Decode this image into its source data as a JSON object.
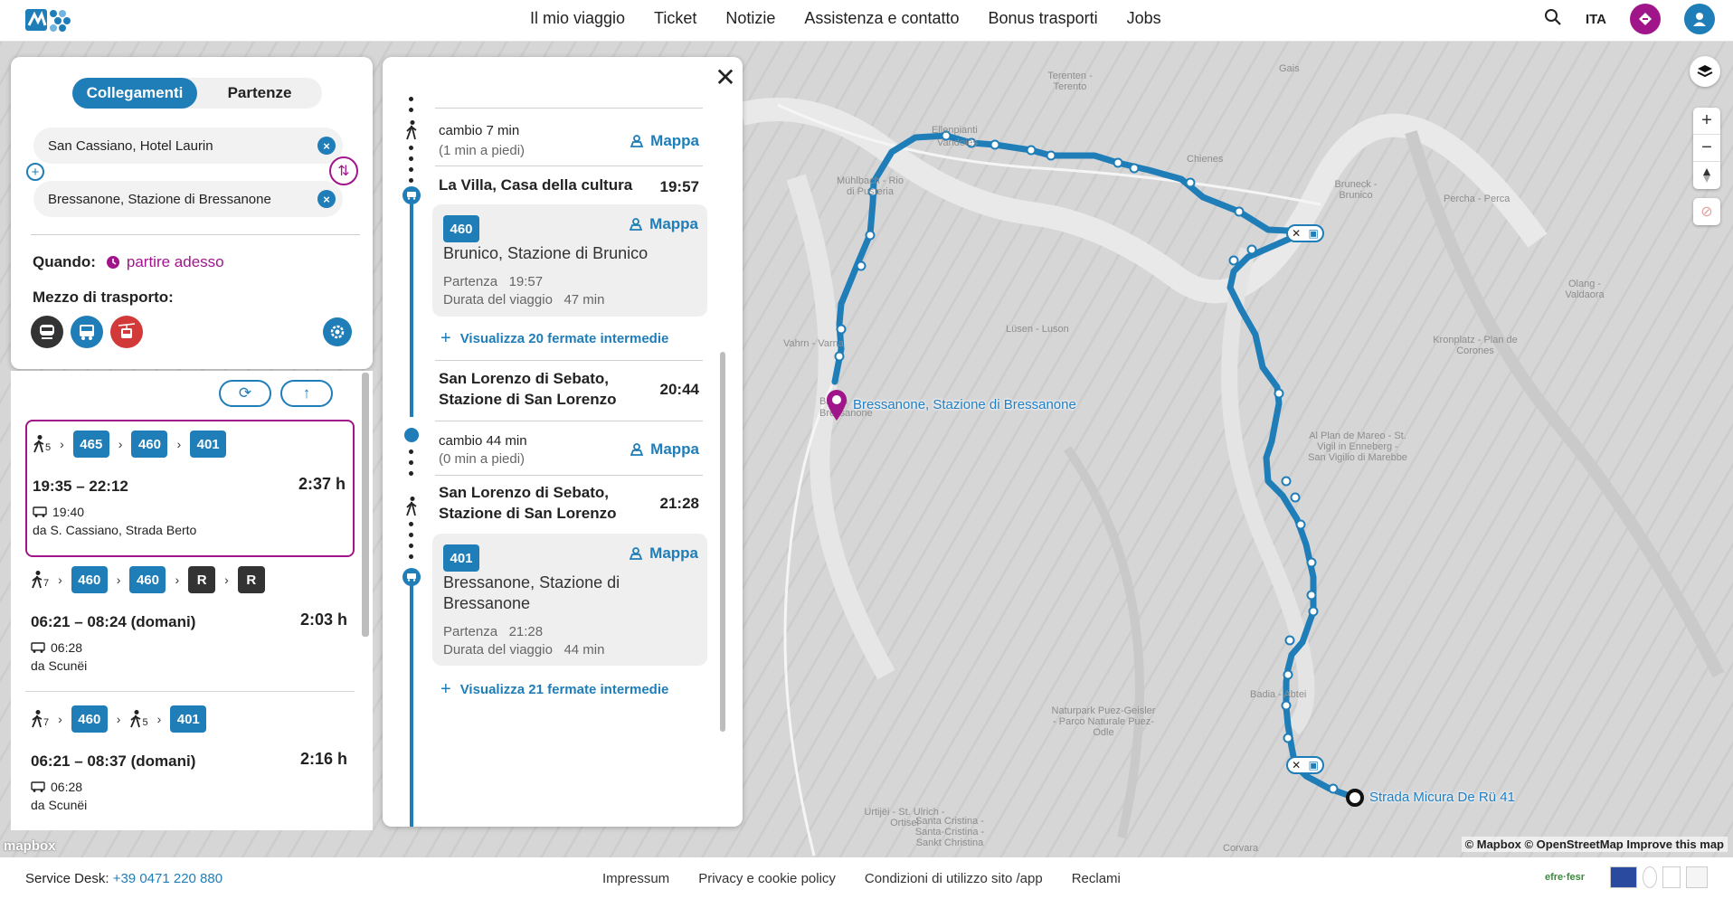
{
  "header": {
    "nav": [
      "Il mio viaggio",
      "Ticket",
      "Notizie",
      "Assistenza e contatto",
      "Bonus trasporti",
      "Jobs"
    ],
    "lang": "ITA"
  },
  "search": {
    "tabs": [
      "Collegamenti",
      "Partenze"
    ],
    "from": "San Cassiano, Hotel Laurin",
    "to": "Bressanone, Stazione di Bressanone",
    "when_label": "Quando:",
    "when_value": "partire adesso",
    "mezzo_label": "Mezzo di trasporto:"
  },
  "results": [
    {
      "walk_sub": "5",
      "lines": [
        "465",
        "460",
        "401"
      ],
      "time": "19:35 – 22:12",
      "duration": "2:37 h",
      "dep_time": "19:40",
      "from_stop": "da S. Cassiano, Strada Berto"
    },
    {
      "walk_sub": "7",
      "lines": [
        "460",
        "460",
        "R",
        "R"
      ],
      "time": "06:21 – 08:24 (domani)",
      "duration": "2:03 h",
      "dep_time": "06:28",
      "from_stop": "da Scunëi"
    },
    {
      "walk_sub": "7",
      "walk_sub2": "5",
      "lines": [
        "460",
        "401"
      ],
      "time": "06:21 – 08:37 (domani)",
      "duration": "2:16 h",
      "dep_time": "06:28",
      "from_stop": "da Scunëi"
    }
  ],
  "detail": {
    "change1": {
      "label": "cambio 7 min",
      "sub": "(1 min a piedi)",
      "map": "Mappa"
    },
    "stop1": {
      "name": "La Villa, Casa della cultura",
      "time": "19:57"
    },
    "leg1": {
      "line": "460",
      "map": "Mappa",
      "dest": "Brunico, Stazione di Brunico",
      "dep_label": "Partenza",
      "dep": "19:57",
      "dur_label": "Durata del viaggio",
      "dur": "47 min"
    },
    "show1": "Visualizza 20 fermate intermedie",
    "stop2": {
      "name_l1": "San Lorenzo di Sebato,",
      "name_l2": "Stazione di San Lorenzo",
      "time": "20:44"
    },
    "change2": {
      "label": "cambio 44 min",
      "sub": "(0 min a piedi)",
      "map": "Mappa"
    },
    "stop3": {
      "name_l1": "San Lorenzo di Sebato,",
      "name_l2": "Stazione di San Lorenzo",
      "time": "21:28"
    },
    "leg2": {
      "line": "401",
      "map": "Mappa",
      "dest_l1": "Bressanone, Stazione di",
      "dest_l2": "Bressanone",
      "dep_label": "Partenza",
      "dep": "21:28",
      "dur_label": "Durata del viaggio",
      "dur": "44 min"
    },
    "show2": "Visualizza 21 fermate intermedie"
  },
  "map": {
    "dest_label": "Bressanone, Stazione di Bressanone",
    "origin_label": "Strada Micura De Rü 41",
    "attribution": "© Mapbox © OpenStreetMap Improve this map",
    "mapbox": "mapbox",
    "places": [
      "Gais",
      "Terenten - Terento",
      "Ellenpianti",
      "Vandoies",
      "Chienes",
      "Bruneck - Brunico",
      "Percha - Perca",
      "Olang - Valdaora",
      "Mühlbach - Rio di Pusteria",
      "Vahrn - Varna",
      "Lüsen - Luson",
      "Kronplatz - Plan de Corones",
      "Al Plan de Mareo - St. Vigil in Enneberg - San Vigilio di Marebbe",
      "Badia - Abtei",
      "Naturpark Puez-Geisler - Parco Naturale Puez-Odle",
      "Urtijëi - St. Ulrich - Ortisei",
      "Santa Cristina - Santa-Cristina - Sankt Christina",
      "Corvara",
      "Brixen",
      "Bressanone"
    ],
    "route_color": "#1f7db8"
  },
  "footer": {
    "desk_label": "Service Desk:",
    "desk_phone": "+39 0471 220 880",
    "links": [
      "Impressum",
      "Privacy e cookie policy",
      "Condizioni di utilizzo sito /app",
      "Reclami"
    ],
    "efre": "efre·fesr"
  }
}
